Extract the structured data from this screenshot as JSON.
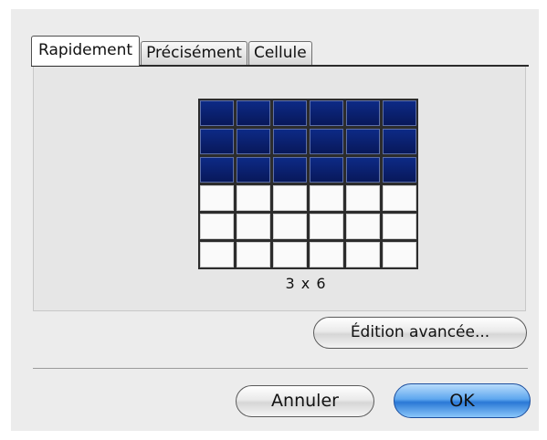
{
  "tabs": [
    {
      "label": "Rapidement",
      "active": true
    },
    {
      "label": "Précisément",
      "active": false
    },
    {
      "label": "Cellule",
      "active": false
    }
  ],
  "table_grid": {
    "rows": 6,
    "columns": 6,
    "selected_rows": 3,
    "selected_columns": 6,
    "selection_color": "#0a1f6e",
    "size_label": "3 x 6"
  },
  "buttons": {
    "advanced_label": "Édition avancée...",
    "cancel_label": "Annuler",
    "ok_label": "OK"
  }
}
